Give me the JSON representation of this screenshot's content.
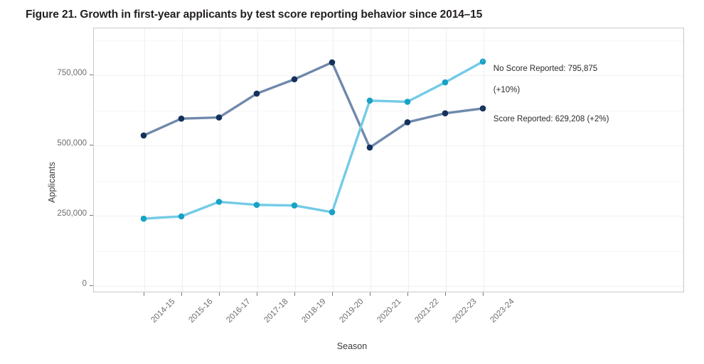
{
  "figure": {
    "title": "Figure 21. Growth in first-year applicants by test score reporting behavior since 2014–15"
  },
  "axes": {
    "y_title": "Applicants",
    "x_title": "Season",
    "y_ticks": [
      "0",
      "250,000",
      "500,000",
      "750,000"
    ],
    "x_ticks": [
      "2014-15",
      "2015-16",
      "2016-17",
      "2017-18",
      "2018-19",
      "2019-20",
      "2020-21",
      "2021-22",
      "2022-23",
      "2023-24"
    ]
  },
  "annotations": {
    "no_score_line1": "No Score Reported: 795,875",
    "no_score_line2": "(+10%)",
    "score_line1": "Score Reported: 629,208 (+2%)"
  },
  "colors": {
    "no_score_line": "#73cbe6",
    "no_score_marker": "#17a2c6",
    "score_line": "#7089ab",
    "score_marker": "#13315c",
    "panel_border": "#c9c9c9",
    "gridline": "#efefef",
    "tick_text": "#6d6d6d",
    "title_text": "#231f20"
  },
  "chart_data": {
    "type": "line",
    "title": "Figure 21. Growth in first-year applicants by test score reporting behavior since 2014–15",
    "xlabel": "Season",
    "ylabel": "Applicants",
    "categories": [
      "2014-15",
      "2015-16",
      "2016-17",
      "2017-18",
      "2018-19",
      "2019-20",
      "2020-21",
      "2021-22",
      "2022-23",
      "2023-24"
    ],
    "ylim": [
      0,
      850000
    ],
    "yticks": [
      0,
      250000,
      500000,
      750000
    ],
    "grid": true,
    "legend": "annotated-at-line-end",
    "series": [
      {
        "name": "Score Reported",
        "color": "#7089ab",
        "marker_color": "#13315c",
        "values": [
          533000,
          593000,
          597000,
          682000,
          733000,
          793000,
          490000,
          580000,
          612000,
          629208
        ],
        "end_label": "Score Reported: 629,208 (+2%)",
        "growth_since_2014_15": "+2%"
      },
      {
        "name": "No Score Reported",
        "color": "#73cbe6",
        "marker_color": "#17a2c6",
        "values": [
          237000,
          245000,
          297000,
          286000,
          284000,
          260000,
          657000,
          653000,
          722000,
          795875
        ],
        "end_label": "No Score Reported: 795,875 (+10%)",
        "growth_since_2014_15": "+10%"
      }
    ]
  }
}
